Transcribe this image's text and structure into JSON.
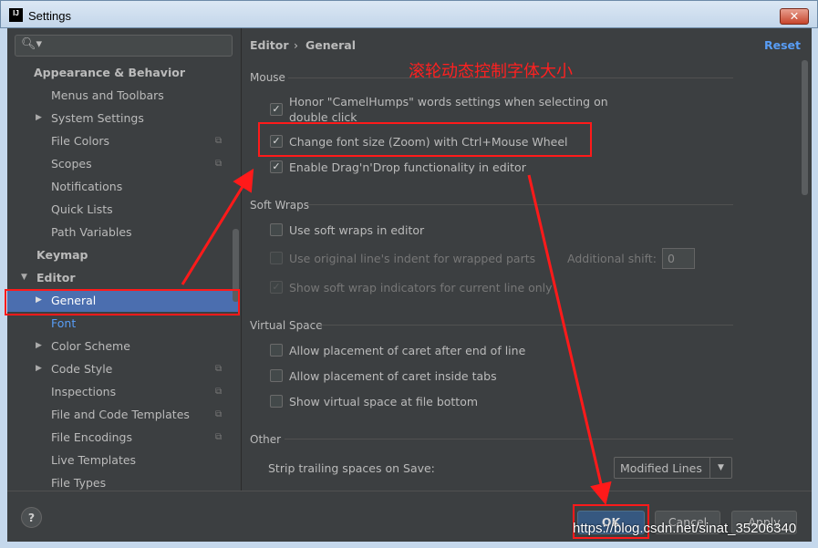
{
  "window": {
    "title": "Settings",
    "icon": "IJ"
  },
  "sidebar": {
    "items": [
      {
        "label": "Appearance & Behavior",
        "level": 0,
        "bold": true
      },
      {
        "label": "Menus and Toolbars",
        "level": 1
      },
      {
        "label": "System Settings",
        "level": 1,
        "arrow": true
      },
      {
        "label": "File Colors",
        "level": 1,
        "copy": true
      },
      {
        "label": "Scopes",
        "level": 1,
        "copy": true
      },
      {
        "label": "Notifications",
        "level": 1
      },
      {
        "label": "Quick Lists",
        "level": 1
      },
      {
        "label": "Path Variables",
        "level": 1
      },
      {
        "label": "Keymap",
        "level": 0,
        "bold": true
      },
      {
        "label": "Editor",
        "level": 0,
        "bold": true,
        "expanded": true
      },
      {
        "label": "General",
        "level": 1,
        "arrow": true,
        "selected": true
      },
      {
        "label": "Font",
        "level": 1,
        "link": true
      },
      {
        "label": "Color Scheme",
        "level": 1,
        "arrow": true
      },
      {
        "label": "Code Style",
        "level": 1,
        "arrow": true,
        "copy": true
      },
      {
        "label": "Inspections",
        "level": 1,
        "copy": true
      },
      {
        "label": "File and Code Templates",
        "level": 1,
        "copy": true
      },
      {
        "label": "File Encodings",
        "level": 1,
        "copy": true
      },
      {
        "label": "Live Templates",
        "level": 1
      },
      {
        "label": "File Types",
        "level": 1
      }
    ]
  },
  "main": {
    "breadcrumb": [
      "Editor",
      "General"
    ],
    "reset": "Reset",
    "sections": {
      "mouse": "Mouse",
      "soft_wraps": "Soft Wraps",
      "virtual_space": "Virtual Space",
      "other": "Other"
    },
    "options": {
      "camelhumps": {
        "label1": "Honor \"CamelHumps\" words settings when selecting on",
        "label2": "double click",
        "checked": true
      },
      "zoom": {
        "label": "Change font size (Zoom) with Ctrl+Mouse Wheel",
        "checked": true
      },
      "dragdrop": {
        "label": "Enable Drag'n'Drop functionality in editor",
        "checked": true
      },
      "soft_wraps": {
        "label": "Use soft wraps in editor",
        "checked": false
      },
      "indent": {
        "label": "Use original line's indent for wrapped parts",
        "checked": false,
        "disabled": true
      },
      "indicators": {
        "label": "Show soft wrap indicators for current line only",
        "checked": true,
        "disabled": true
      },
      "caret_end": {
        "label": "Allow placement of caret after end of line",
        "checked": false
      },
      "caret_tabs": {
        "label": "Allow placement of caret inside tabs",
        "checked": false
      },
      "virtual_bottom": {
        "label": "Show virtual space at file bottom",
        "checked": false
      }
    },
    "additional_shift": {
      "label": "Additional shift:",
      "value": "0"
    },
    "strip_trailing": {
      "label": "Strip trailing spaces on Save:",
      "value": "Modified Lines"
    }
  },
  "buttons": {
    "help": "?",
    "ok": "OK",
    "cancel": "Cancel",
    "apply": "Apply"
  },
  "annotation": "滚轮动态控制字体大小",
  "watermark": "https://blog.csdn.net/sinat_35206340",
  "colors": {
    "selection": "#4b6eaf",
    "background": "#3c3f41",
    "link": "#589df6",
    "annotation": "#ff1a1a"
  }
}
